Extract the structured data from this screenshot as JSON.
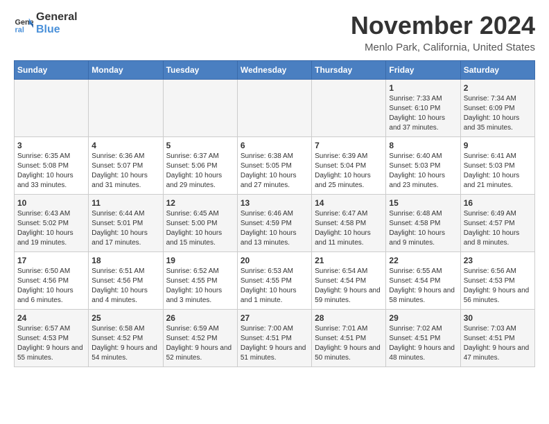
{
  "logo": {
    "line1": "General",
    "line2": "Blue"
  },
  "title": "November 2024",
  "location": "Menlo Park, California, United States",
  "weekdays": [
    "Sunday",
    "Monday",
    "Tuesday",
    "Wednesday",
    "Thursday",
    "Friday",
    "Saturday"
  ],
  "weeks": [
    [
      {
        "day": "",
        "info": ""
      },
      {
        "day": "",
        "info": ""
      },
      {
        "day": "",
        "info": ""
      },
      {
        "day": "",
        "info": ""
      },
      {
        "day": "",
        "info": ""
      },
      {
        "day": "1",
        "info": "Sunrise: 7:33 AM\nSunset: 6:10 PM\nDaylight: 10 hours and 37 minutes."
      },
      {
        "day": "2",
        "info": "Sunrise: 7:34 AM\nSunset: 6:09 PM\nDaylight: 10 hours and 35 minutes."
      }
    ],
    [
      {
        "day": "3",
        "info": "Sunrise: 6:35 AM\nSunset: 5:08 PM\nDaylight: 10 hours and 33 minutes."
      },
      {
        "day": "4",
        "info": "Sunrise: 6:36 AM\nSunset: 5:07 PM\nDaylight: 10 hours and 31 minutes."
      },
      {
        "day": "5",
        "info": "Sunrise: 6:37 AM\nSunset: 5:06 PM\nDaylight: 10 hours and 29 minutes."
      },
      {
        "day": "6",
        "info": "Sunrise: 6:38 AM\nSunset: 5:05 PM\nDaylight: 10 hours and 27 minutes."
      },
      {
        "day": "7",
        "info": "Sunrise: 6:39 AM\nSunset: 5:04 PM\nDaylight: 10 hours and 25 minutes."
      },
      {
        "day": "8",
        "info": "Sunrise: 6:40 AM\nSunset: 5:03 PM\nDaylight: 10 hours and 23 minutes."
      },
      {
        "day": "9",
        "info": "Sunrise: 6:41 AM\nSunset: 5:03 PM\nDaylight: 10 hours and 21 minutes."
      }
    ],
    [
      {
        "day": "10",
        "info": "Sunrise: 6:43 AM\nSunset: 5:02 PM\nDaylight: 10 hours and 19 minutes."
      },
      {
        "day": "11",
        "info": "Sunrise: 6:44 AM\nSunset: 5:01 PM\nDaylight: 10 hours and 17 minutes."
      },
      {
        "day": "12",
        "info": "Sunrise: 6:45 AM\nSunset: 5:00 PM\nDaylight: 10 hours and 15 minutes."
      },
      {
        "day": "13",
        "info": "Sunrise: 6:46 AM\nSunset: 4:59 PM\nDaylight: 10 hours and 13 minutes."
      },
      {
        "day": "14",
        "info": "Sunrise: 6:47 AM\nSunset: 4:58 PM\nDaylight: 10 hours and 11 minutes."
      },
      {
        "day": "15",
        "info": "Sunrise: 6:48 AM\nSunset: 4:58 PM\nDaylight: 10 hours and 9 minutes."
      },
      {
        "day": "16",
        "info": "Sunrise: 6:49 AM\nSunset: 4:57 PM\nDaylight: 10 hours and 8 minutes."
      }
    ],
    [
      {
        "day": "17",
        "info": "Sunrise: 6:50 AM\nSunset: 4:56 PM\nDaylight: 10 hours and 6 minutes."
      },
      {
        "day": "18",
        "info": "Sunrise: 6:51 AM\nSunset: 4:56 PM\nDaylight: 10 hours and 4 minutes."
      },
      {
        "day": "19",
        "info": "Sunrise: 6:52 AM\nSunset: 4:55 PM\nDaylight: 10 hours and 3 minutes."
      },
      {
        "day": "20",
        "info": "Sunrise: 6:53 AM\nSunset: 4:55 PM\nDaylight: 10 hours and 1 minute."
      },
      {
        "day": "21",
        "info": "Sunrise: 6:54 AM\nSunset: 4:54 PM\nDaylight: 9 hours and 59 minutes."
      },
      {
        "day": "22",
        "info": "Sunrise: 6:55 AM\nSunset: 4:54 PM\nDaylight: 9 hours and 58 minutes."
      },
      {
        "day": "23",
        "info": "Sunrise: 6:56 AM\nSunset: 4:53 PM\nDaylight: 9 hours and 56 minutes."
      }
    ],
    [
      {
        "day": "24",
        "info": "Sunrise: 6:57 AM\nSunset: 4:53 PM\nDaylight: 9 hours and 55 minutes."
      },
      {
        "day": "25",
        "info": "Sunrise: 6:58 AM\nSunset: 4:52 PM\nDaylight: 9 hours and 54 minutes."
      },
      {
        "day": "26",
        "info": "Sunrise: 6:59 AM\nSunset: 4:52 PM\nDaylight: 9 hours and 52 minutes."
      },
      {
        "day": "27",
        "info": "Sunrise: 7:00 AM\nSunset: 4:51 PM\nDaylight: 9 hours and 51 minutes."
      },
      {
        "day": "28",
        "info": "Sunrise: 7:01 AM\nSunset: 4:51 PM\nDaylight: 9 hours and 50 minutes."
      },
      {
        "day": "29",
        "info": "Sunrise: 7:02 AM\nSunset: 4:51 PM\nDaylight: 9 hours and 48 minutes."
      },
      {
        "day": "30",
        "info": "Sunrise: 7:03 AM\nSunset: 4:51 PM\nDaylight: 9 hours and 47 minutes."
      }
    ]
  ]
}
